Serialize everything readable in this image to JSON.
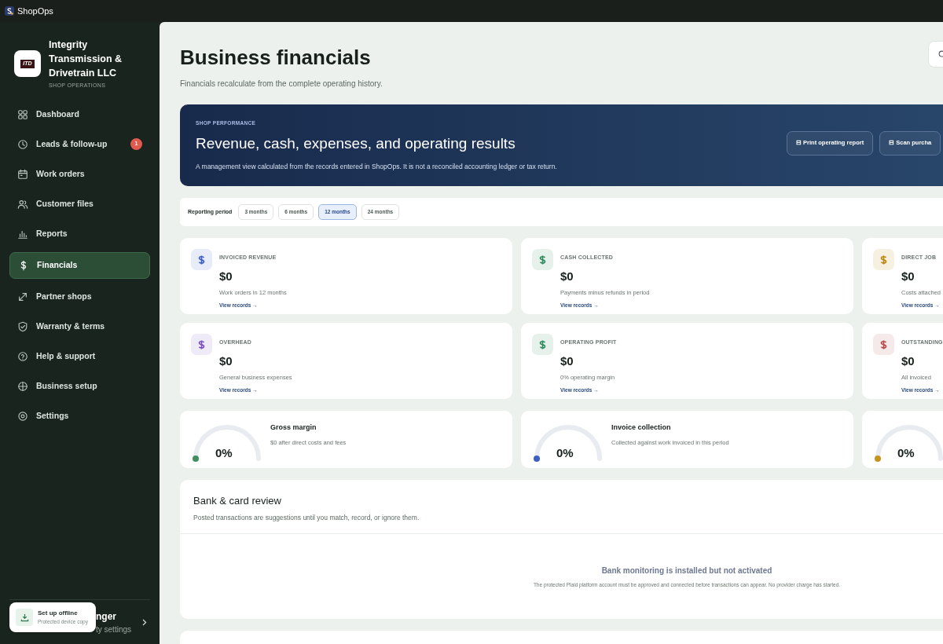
{
  "window": {
    "title": "ShopOps"
  },
  "sidebar": {
    "business_name": "Integrity Transmission & Drivetrain LLC",
    "logo_text": "ITD",
    "subtitle": "SHOP OPERATIONS",
    "items": [
      {
        "label": "Dashboard",
        "selected": false
      },
      {
        "label": "Leads & follow-up",
        "selected": false,
        "badge": "1"
      },
      {
        "label": "Work orders",
        "selected": false
      },
      {
        "label": "Customer files",
        "selected": false
      },
      {
        "label": "Reports",
        "selected": false
      },
      {
        "label": "Financials",
        "selected": true
      },
      {
        "label": "Partner shops",
        "selected": false
      },
      {
        "label": "Warranty & terms",
        "selected": false
      },
      {
        "label": "Help & support",
        "selected": false
      },
      {
        "label": "Business setup",
        "selected": false
      },
      {
        "label": "Settings",
        "selected": false
      }
    ],
    "footer": {
      "name": "nger",
      "detail": "ty settings"
    },
    "offline": {
      "title": "Set up offline",
      "subtitle": "Protected device copy"
    }
  },
  "page": {
    "title": "Business financials",
    "subtitle": "Financials recalculate from the complete operating history."
  },
  "hero": {
    "eyebrow": "SHOP PERFORMANCE",
    "title": "Revenue, cash, expenses, and operating results",
    "text": "A management view calculated from the records entered in ShopOps. It is not a reconciled accounting ledger or tax return.",
    "buttons": [
      "⊟ Print operating report",
      "⊟ Scan purcha"
    ]
  },
  "period": {
    "label": "Reporting period",
    "options": [
      {
        "label": "3 months",
        "selected": false
      },
      {
        "label": "6 months",
        "selected": false
      },
      {
        "label": "12 months",
        "selected": true
      },
      {
        "label": "24 months",
        "selected": false
      }
    ]
  },
  "metrics": [
    {
      "label": "INVOICED REVENUE",
      "value": "$0",
      "note": "Work orders in 12 months",
      "link": "View records →",
      "color": "#3b5fc4"
    },
    {
      "label": "CASH COLLECTED",
      "value": "$0",
      "note": "Payments minus refunds in period",
      "link": "View records →",
      "color": "#2f8a5c"
    },
    {
      "label": "DIRECT JOB",
      "value": "$0",
      "note": "Costs attached",
      "link": "View records →",
      "color": "#b8860b"
    },
    {
      "label": "OVERHEAD",
      "value": "$0",
      "note": "General business expenses",
      "link": "View records →",
      "color": "#7b4fc4"
    },
    {
      "label": "OPERATING PROFIT",
      "value": "$0",
      "note": "0% operating margin",
      "link": "View records →",
      "color": "#2f8a5c"
    },
    {
      "label": "OUTSTANDING",
      "value": "$0",
      "note": "All invoiced",
      "link": "View records →",
      "color": "#b84a4a"
    }
  ],
  "gauges": [
    {
      "value": "0%",
      "title": "Gross margin",
      "note": "$0 after direct costs and fees",
      "level": 0,
      "color": "#3f8f5f"
    },
    {
      "value": "0%",
      "title": "Invoice collection",
      "note": "Collected against work invoiced in this period",
      "level": 0,
      "color": "#3b5fc4"
    },
    {
      "value": "0%",
      "level": 0,
      "color": "#c8921e"
    }
  ],
  "bank_review": {
    "title": "Bank & card review",
    "subtitle": "Posted transactions are suggestions until you match, record, or ignore them.",
    "empty_title": "Bank monitoring is installed but not activated",
    "empty_text": "The protected Plaid platform account must be approved and connected before transactions can appear. No provider charge has started."
  }
}
